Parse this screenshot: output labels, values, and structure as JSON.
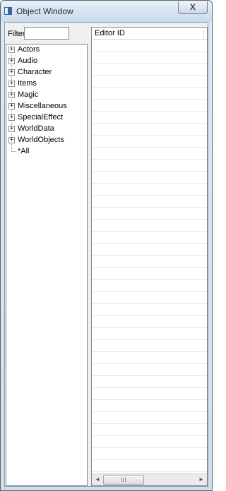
{
  "window": {
    "title": "Object Window",
    "close_label": "X"
  },
  "filter": {
    "label": "Filter",
    "value": "",
    "placeholder": ""
  },
  "tree": {
    "items": [
      {
        "label": "Actors",
        "expandable": true
      },
      {
        "label": "Audio",
        "expandable": true
      },
      {
        "label": "Character",
        "expandable": true
      },
      {
        "label": "Items",
        "expandable": true
      },
      {
        "label": "Magic",
        "expandable": true
      },
      {
        "label": "Miscellaneous",
        "expandable": true
      },
      {
        "label": "SpecialEffect",
        "expandable": true
      },
      {
        "label": "WorldData",
        "expandable": true
      },
      {
        "label": "WorldObjects",
        "expandable": true
      },
      {
        "label": "*All",
        "expandable": false
      }
    ],
    "expander_glyph": "+"
  },
  "list": {
    "column_header": "Editor ID",
    "rows": []
  },
  "scrollbar": {
    "left_arrow": "◄",
    "right_arrow": "►"
  }
}
